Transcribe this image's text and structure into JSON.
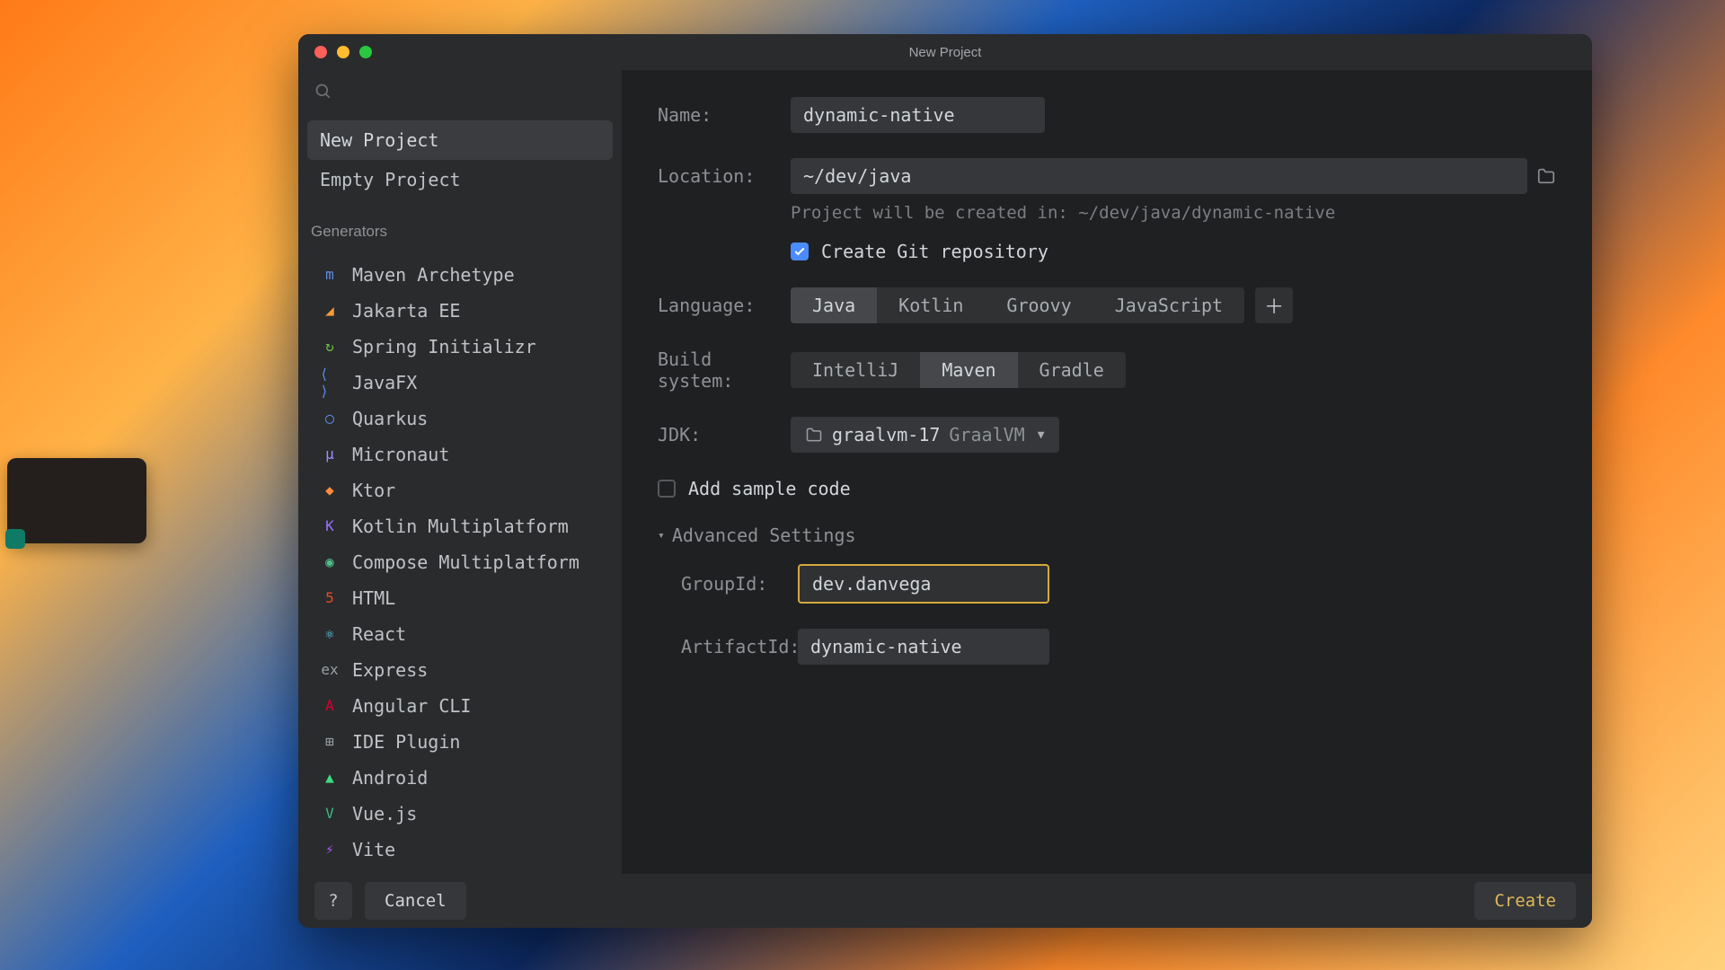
{
  "window_title": "New Project",
  "sidebar": {
    "project_items": [
      "New Project",
      "Empty Project"
    ],
    "active_project_index": 0,
    "generators_header": "Generators",
    "generators": [
      {
        "icon": "m",
        "color": "#5c8de6",
        "label": "Maven Archetype"
      },
      {
        "icon": "◢",
        "color": "#f29d38",
        "label": "Jakarta EE"
      },
      {
        "icon": "↻",
        "color": "#6bbf4a",
        "label": "Spring Initializr"
      },
      {
        "icon": "⟨ ⟩",
        "color": "#5c8de6",
        "label": "JavaFX"
      },
      {
        "icon": "◯",
        "color": "#5c8de6",
        "label": "Quarkus"
      },
      {
        "icon": "μ",
        "color": "#a58cff",
        "label": "Micronaut"
      },
      {
        "icon": "◆",
        "color": "#ff8a3d",
        "label": "Ktor"
      },
      {
        "icon": "K",
        "color": "#9a70ff",
        "label": "Kotlin Multiplatform"
      },
      {
        "icon": "◉",
        "color": "#4fc08d",
        "label": "Compose Multiplatform"
      },
      {
        "icon": "5",
        "color": "#e44d26",
        "label": "HTML"
      },
      {
        "icon": "⚛",
        "color": "#61dafb",
        "label": "React"
      },
      {
        "icon": "ex",
        "color": "#9aa0a6",
        "label": "Express"
      },
      {
        "icon": "A",
        "color": "#dd0031",
        "label": "Angular CLI"
      },
      {
        "icon": "⊞",
        "color": "#9aa0a6",
        "label": "IDE Plugin"
      },
      {
        "icon": "▲",
        "color": "#3ddc84",
        "label": "Android"
      },
      {
        "icon": "V",
        "color": "#41b883",
        "label": "Vue.js"
      },
      {
        "icon": "⚡",
        "color": "#a855f7",
        "label": "Vite"
      }
    ]
  },
  "form": {
    "name_label": "Name:",
    "name_value": "dynamic-native",
    "location_label": "Location:",
    "location_value": "~/dev/java",
    "location_hint": "Project will be created in: ~/dev/java/dynamic-native",
    "git_label": "Create Git repository",
    "git_checked": true,
    "language_label": "Language:",
    "languages": [
      "Java",
      "Kotlin",
      "Groovy",
      "JavaScript"
    ],
    "language_active": 0,
    "build_label": "Build system:",
    "build_systems": [
      "IntelliJ",
      "Maven",
      "Gradle"
    ],
    "build_active": 1,
    "jdk_label": "JDK:",
    "jdk_value": "graalvm-17",
    "jdk_suffix": "GraalVM",
    "sample_label": "Add sample code",
    "sample_checked": false,
    "advanced_label": "Advanced Settings",
    "group_id_label": "GroupId:",
    "group_id_value": "dev.danvega",
    "artifact_id_label": "ArtifactId:",
    "artifact_id_value": "dynamic-native"
  },
  "footer": {
    "help": "?",
    "cancel": "Cancel",
    "create": "Create"
  }
}
